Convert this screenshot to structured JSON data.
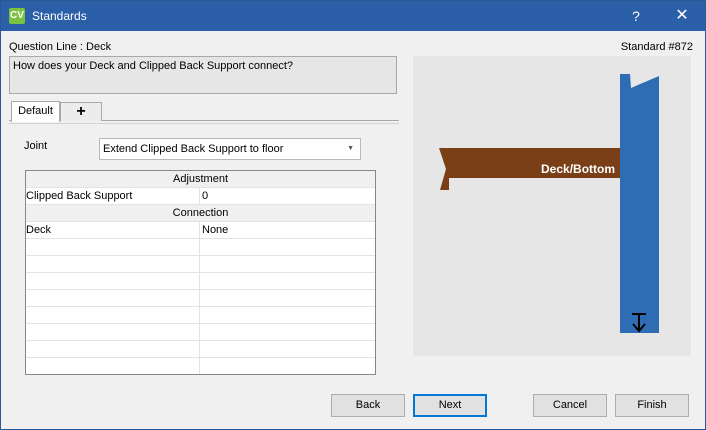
{
  "window": {
    "app_logo": "CV",
    "title": "Standards",
    "help_label": "?",
    "close_label": "✕"
  },
  "question": {
    "line_label": "Question Line : Deck",
    "standard_label": "Standard #872",
    "text": "How does your Deck and Clipped Back Support connect?"
  },
  "tabs": {
    "default_label": "Default",
    "add_label": "+"
  },
  "joint": {
    "label": "Joint",
    "selected": "Extend Clipped Back Support to floor"
  },
  "grid": {
    "sections": [
      {
        "title": "Adjustment",
        "rows": [
          {
            "name": "Clipped Back Support",
            "value": "0"
          }
        ]
      },
      {
        "title": "Connection",
        "rows": [
          {
            "name": "Deck",
            "value": "None"
          }
        ]
      }
    ]
  },
  "preview": {
    "deck_label": "Deck/Bottom",
    "colors": {
      "deck": "#7b3f18",
      "post": "#2e6db4",
      "background": "#e6e6e6"
    }
  },
  "buttons": {
    "back": "Back",
    "next": "Next",
    "cancel": "Cancel",
    "finish": "Finish"
  }
}
